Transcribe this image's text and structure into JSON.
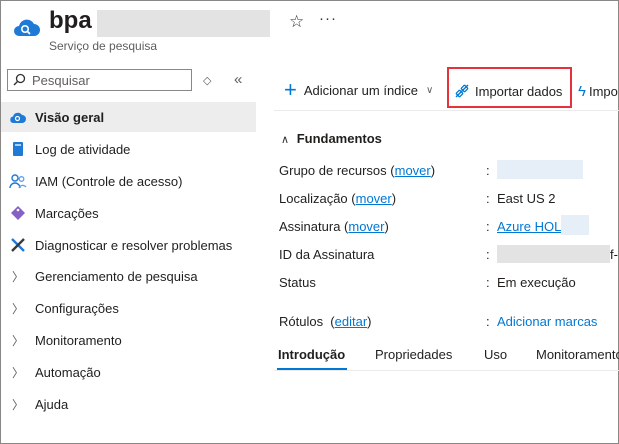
{
  "header": {
    "resource_name": "bpa",
    "resource_type": "Serviço de pesquisa"
  },
  "search": {
    "placeholder": "Pesquisar"
  },
  "sidebar": {
    "items": [
      {
        "label": "Visão geral",
        "icon": "cloud-icon",
        "active": true
      },
      {
        "label": "Log de atividade",
        "icon": "book-icon"
      },
      {
        "label": "IAM (Controle de acesso)",
        "icon": "people-icon"
      },
      {
        "label": "Marcações",
        "icon": "tag-icon"
      },
      {
        "label": "Diagnosticar e resolver problemas",
        "icon": "wrench-icon"
      },
      {
        "label": "Gerenciamento de pesquisa",
        "icon": "chevron-right-icon"
      },
      {
        "label": "Configurações",
        "icon": "chevron-right-icon"
      },
      {
        "label": "Monitoramento",
        "icon": "chevron-right-icon"
      },
      {
        "label": "Automação",
        "icon": "chevron-right-icon"
      },
      {
        "label": "Ajuda",
        "icon": "chevron-right-icon"
      }
    ]
  },
  "toolbar": {
    "add_index": "Adicionar um índice",
    "import_data": "Importar dados",
    "import_more": "Impo"
  },
  "essentials": {
    "title": "Fundamentos",
    "rows": {
      "resource_group": {
        "label": "Grupo de recursos",
        "link": "mover"
      },
      "location": {
        "label": "Localização",
        "link": "mover",
        "value": "East US 2"
      },
      "subscription": {
        "label": "Assinatura",
        "link": "mover",
        "value": "Azure HOL"
      },
      "subscription_id": {
        "label": "ID da Assinatura",
        "value": "f-"
      },
      "status": {
        "label": "Status",
        "value": "Em execução"
      },
      "tags": {
        "label": "Rótulos",
        "link": "editar",
        "value": "Adicionar marcas"
      }
    }
  },
  "tabs": [
    {
      "label": "Introdução",
      "active": true
    },
    {
      "label": "Propriedades"
    },
    {
      "label": "Uso"
    },
    {
      "label": "Monitoramento"
    }
  ],
  "colors": {
    "accent": "#0078d4",
    "highlight": "#e5323b"
  }
}
